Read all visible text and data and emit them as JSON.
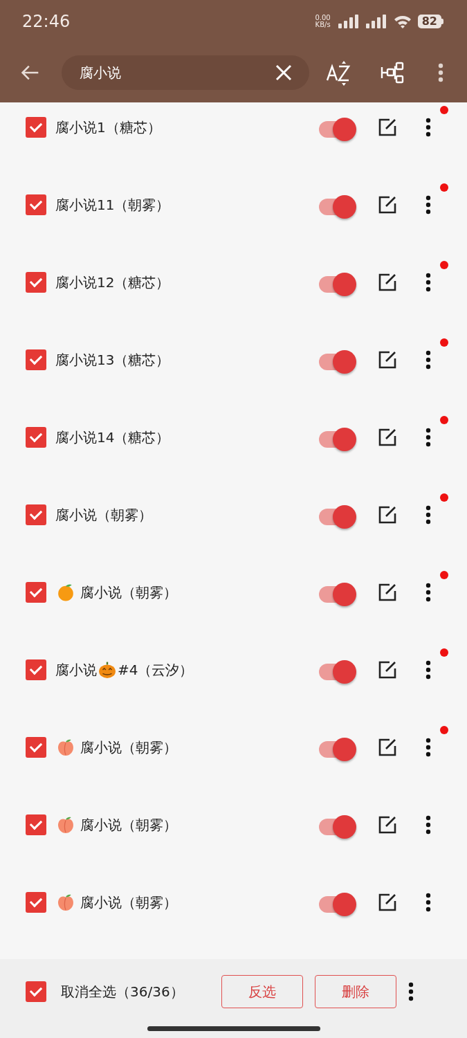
{
  "status_bar": {
    "time": "22:46",
    "net_speed": "0.00",
    "net_unit": "KB/s",
    "battery": "82"
  },
  "app_bar": {
    "search": {
      "value": "腐小说"
    }
  },
  "rows": [
    {
      "parts": [
        {
          "kind": "text",
          "text": "腐小说1（糖芯）"
        }
      ],
      "checked": true,
      "on": true,
      "badge": true
    },
    {
      "parts": [
        {
          "kind": "text",
          "text": "腐小说11（朝雾）"
        }
      ],
      "checked": true,
      "on": true,
      "badge": true
    },
    {
      "parts": [
        {
          "kind": "text",
          "text": "腐小说12（糖芯）"
        }
      ],
      "checked": true,
      "on": true,
      "badge": true
    },
    {
      "parts": [
        {
          "kind": "text",
          "text": "腐小说13（糖芯）"
        }
      ],
      "checked": true,
      "on": true,
      "badge": true
    },
    {
      "parts": [
        {
          "kind": "text",
          "text": "腐小说14（糖芯）"
        }
      ],
      "checked": true,
      "on": true,
      "badge": true
    },
    {
      "parts": [
        {
          "kind": "text",
          "text": "腐小说（朝雾）"
        }
      ],
      "checked": true,
      "on": true,
      "badge": true
    },
    {
      "parts": [
        {
          "kind": "orange"
        },
        {
          "kind": "text",
          "text": "腐小说（朝雾）"
        }
      ],
      "checked": true,
      "on": true,
      "badge": true
    },
    {
      "parts": [
        {
          "kind": "text",
          "text": "腐小说"
        },
        {
          "kind": "pumpkin"
        },
        {
          "kind": "text",
          "text": "#4（云汐）"
        }
      ],
      "checked": true,
      "on": true,
      "badge": true
    },
    {
      "parts": [
        {
          "kind": "peach"
        },
        {
          "kind": "text",
          "text": "腐小说（朝雾）"
        }
      ],
      "checked": true,
      "on": true,
      "badge": true
    },
    {
      "parts": [
        {
          "kind": "peach"
        },
        {
          "kind": "text",
          "text": "腐小说（朝雾）"
        }
      ],
      "checked": true,
      "on": true,
      "badge": false
    },
    {
      "parts": [
        {
          "kind": "peach"
        },
        {
          "kind": "text",
          "text": "腐小说（朝雾）"
        }
      ],
      "checked": true,
      "on": true,
      "badge": false
    }
  ],
  "bottom_bar": {
    "select_all": {
      "label": "取消全选（36/36）",
      "checked": true
    },
    "buttons": [
      "反选",
      "删除"
    ]
  }
}
